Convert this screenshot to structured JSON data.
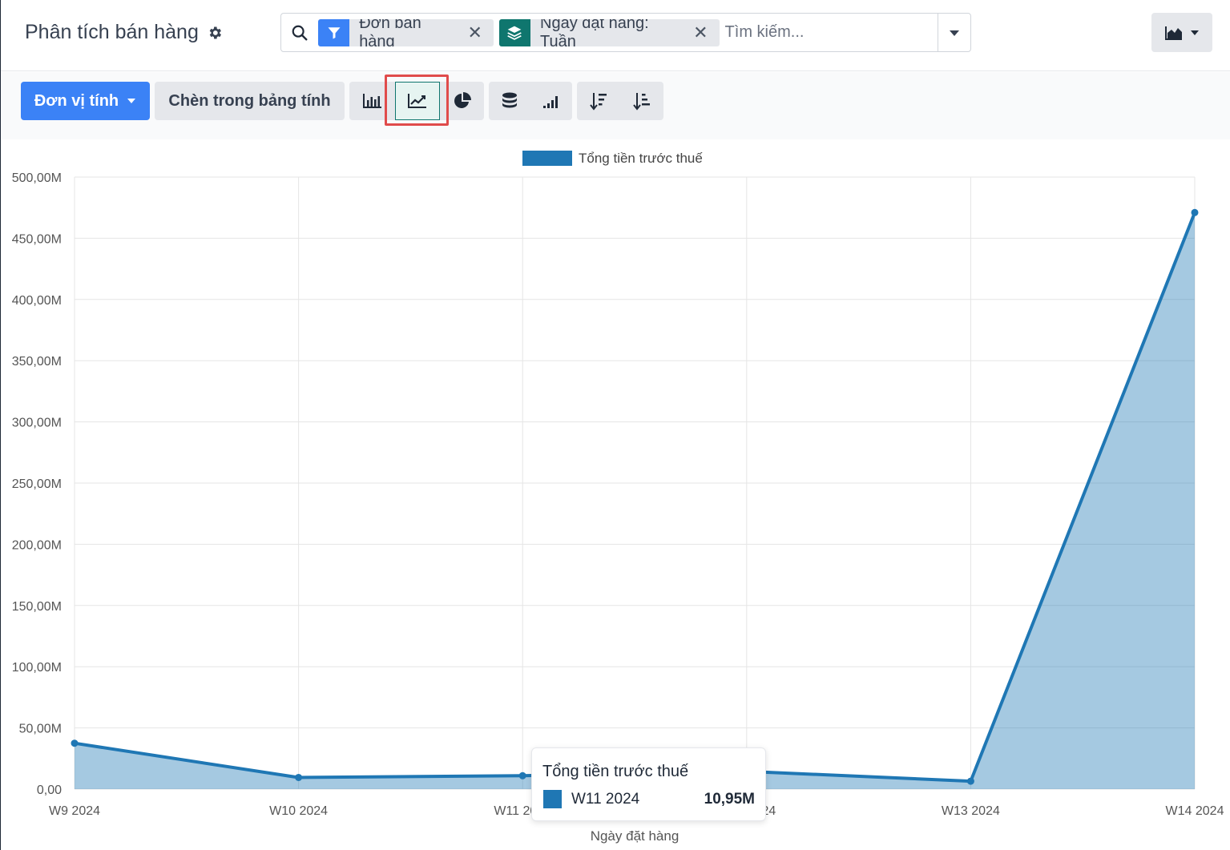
{
  "header": {
    "title": "Phân tích bán hàng",
    "search": {
      "facets": [
        {
          "label": "Đơn bán hàng",
          "icon": "filter-icon"
        },
        {
          "label": "Ngày đặt hàng: Tuần",
          "icon": "layers-icon"
        }
      ],
      "placeholder": "Tìm kiếm..."
    },
    "view_switch_icon": "area-chart-icon"
  },
  "controls": {
    "measures_label": "Đơn vị tính",
    "insert_label": "Chèn trong bảng tính",
    "chart_buttons": [
      "bar-chart-icon",
      "line-chart-icon",
      "pie-chart-icon"
    ],
    "option_buttons": [
      "stacked-icon",
      "cumulative-icon"
    ],
    "sort_buttons": [
      "sort-descending-icon",
      "sort-ascending-icon"
    ],
    "active_chart": "line-chart-icon"
  },
  "chart_data": {
    "type": "area",
    "categories": [
      "W9 2024",
      "W10 2024",
      "W11 2024",
      "W12 2024",
      "W13 2024",
      "W14 2024"
    ],
    "series": [
      {
        "name": "Tổng tiền trước thuế",
        "values": [
          37.5,
          9.5,
          10.95,
          14.5,
          6.5,
          471
        ],
        "color": "#1f77b4"
      }
    ],
    "yticks": [
      "0,00",
      "50,00M",
      "100,00M",
      "150,00M",
      "200,00M",
      "250,00M",
      "300,00M",
      "350,00M",
      "400,00M",
      "450,00M",
      "500,00M"
    ],
    "ylim": [
      0,
      500
    ],
    "xlabel": "Ngày đặt hàng",
    "legend_position": "top",
    "grid": true
  },
  "tooltip": {
    "title": "Tổng tiền trước thuế",
    "label": "W11 2024",
    "value": "10,95M"
  }
}
